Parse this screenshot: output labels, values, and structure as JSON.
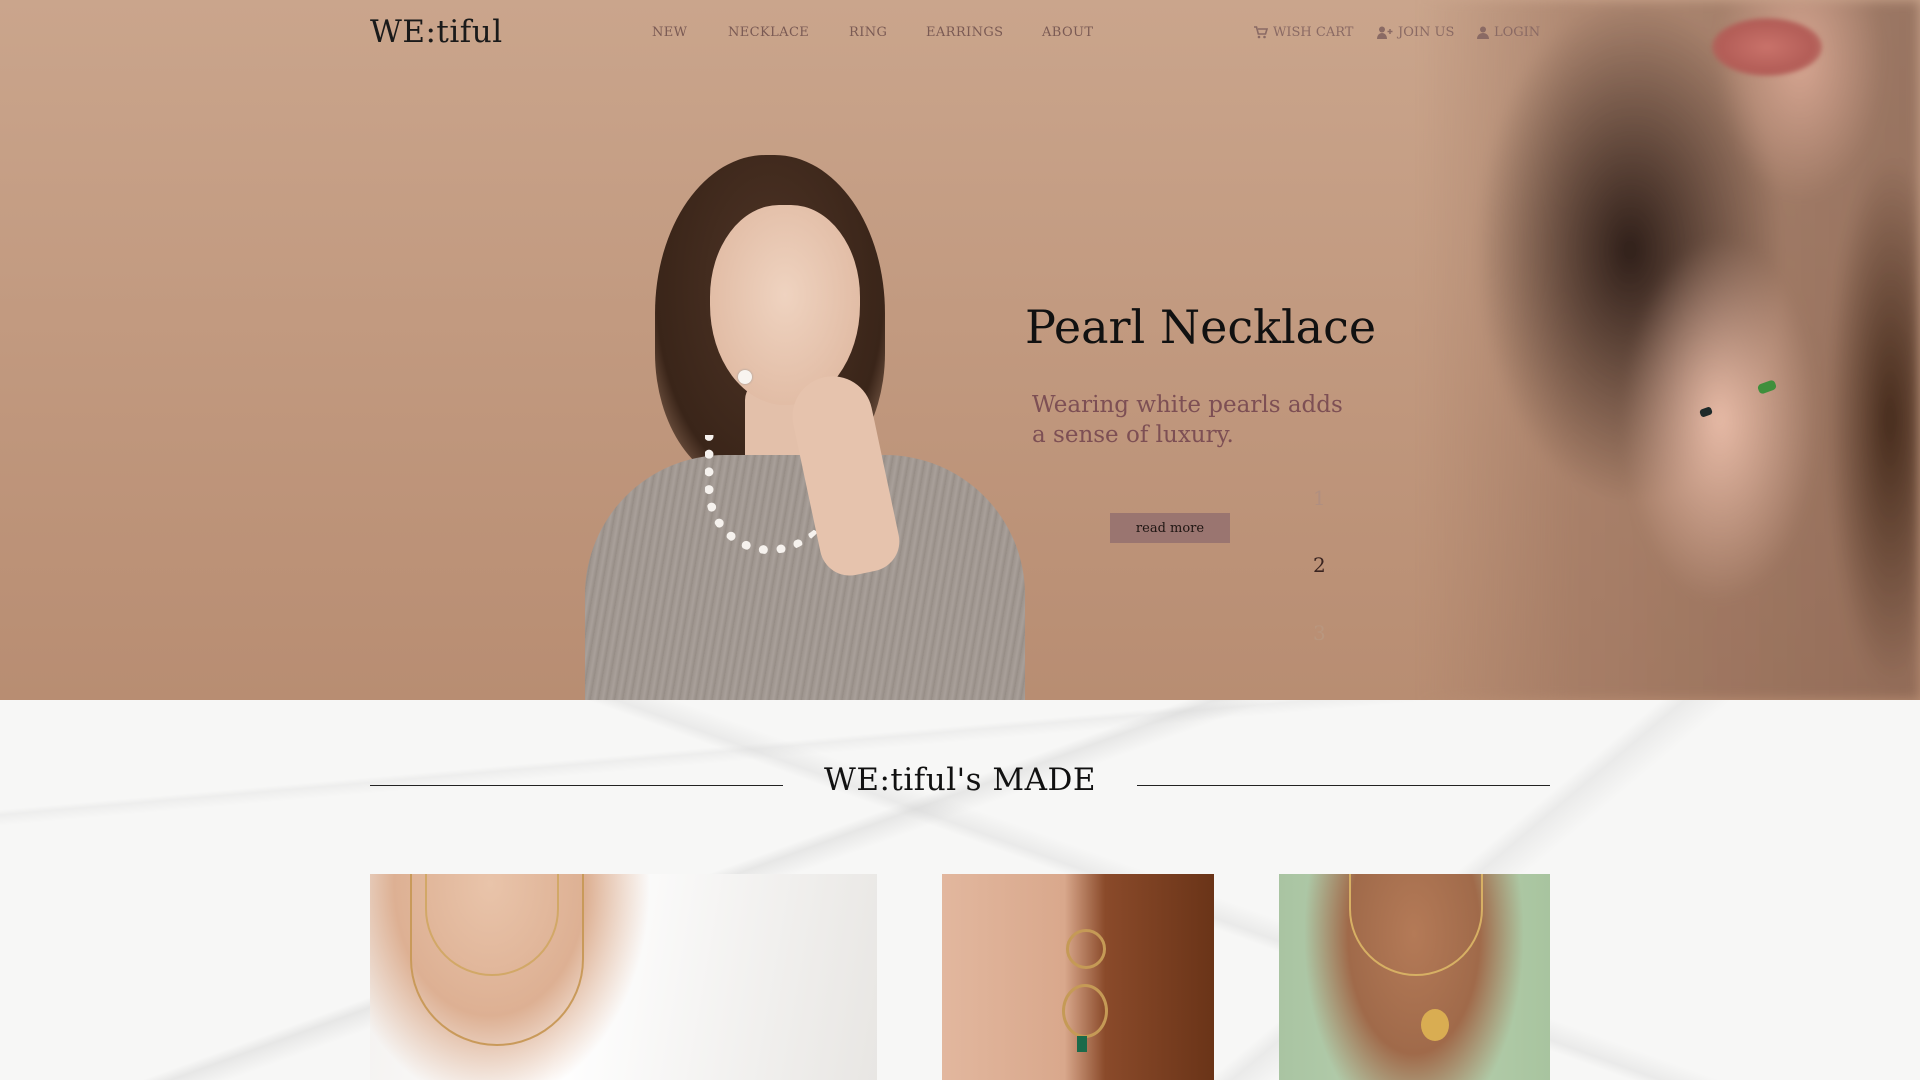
{
  "brand": {
    "logo": "WE:tiful"
  },
  "nav": {
    "items": [
      {
        "label": "NEW"
      },
      {
        "label": "NECKLACE"
      },
      {
        "label": "RING"
      },
      {
        "label": "EARRINGS"
      },
      {
        "label": "ABOUT"
      }
    ]
  },
  "utility": {
    "wish_cart": "WISH CART",
    "join_us": "JOIN US",
    "login": "LOGIN"
  },
  "hero": {
    "title": "Pearl Necklace",
    "subtitle": "Wearing white pearls adds a sense of luxury.",
    "button": "read more",
    "pager": [
      "1",
      "2",
      "3"
    ],
    "active_page": "2"
  },
  "made": {
    "title": "WE:tiful's MADE"
  },
  "colors": {
    "accent": "#9a7570",
    "subtitle": "#7d4f54",
    "nav_text": "#7a5a54"
  },
  "icons": {
    "cart": "cart-icon",
    "join": "user-plus-icon",
    "login": "user-icon"
  }
}
